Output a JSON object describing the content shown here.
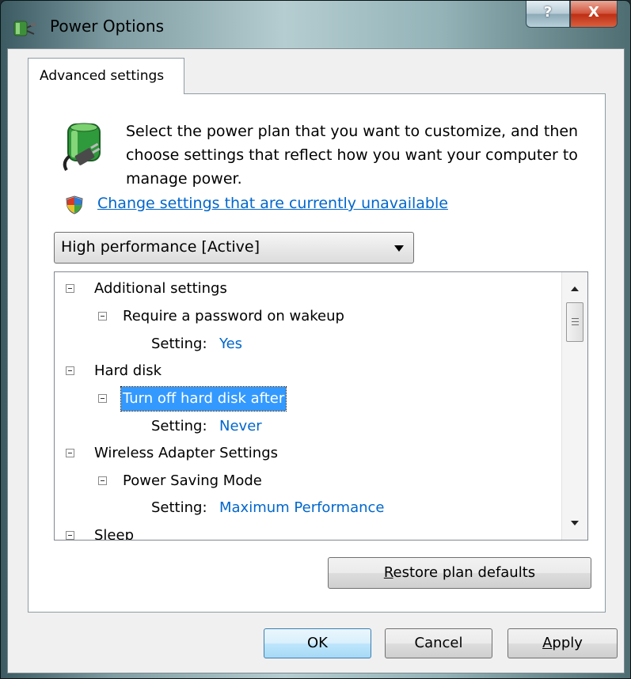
{
  "window": {
    "title": "Power Options",
    "help_label": "?",
    "close_label": "X"
  },
  "tab": {
    "label": "Advanced settings"
  },
  "intro": {
    "text": "Select the power plan that you want to customize, and then choose settings that reflect how you want your computer to manage power."
  },
  "change_link": {
    "text": "Change settings that are currently unavailable"
  },
  "plan_dropdown": {
    "selected": "High performance [Active]"
  },
  "tree": {
    "additional_settings": "Additional settings",
    "require_password": "Require a password on wakeup",
    "require_password_setting_label": "Setting:",
    "require_password_setting_value": "Yes",
    "hard_disk": "Hard disk",
    "turn_off_hard_disk": "Turn off hard disk after",
    "turn_off_setting_label": "Setting:",
    "turn_off_setting_value": "Never",
    "wireless_adapter": "Wireless Adapter Settings",
    "power_saving_mode": "Power Saving Mode",
    "power_saving_setting_label": "Setting:",
    "power_saving_setting_value": "Maximum Performance",
    "sleep": "Sleep"
  },
  "buttons": {
    "restore_mnemonic": "R",
    "restore_rest": "estore plan defaults",
    "ok": "OK",
    "cancel": "Cancel",
    "apply_mnemonic": "A",
    "apply_rest": "pply"
  },
  "colors": {
    "link": "#0066cc",
    "selection": "#3399ff",
    "close_button": "#c7391b"
  }
}
